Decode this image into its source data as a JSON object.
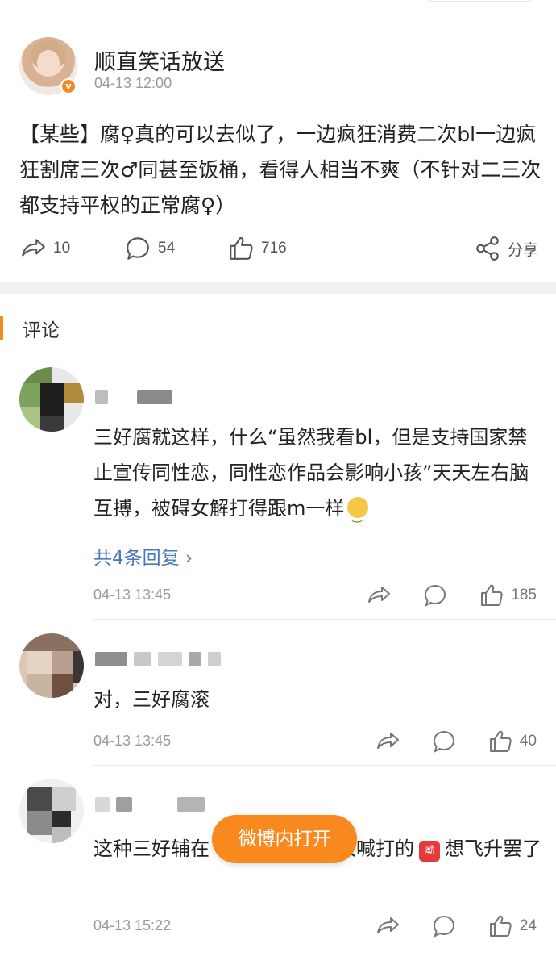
{
  "post": {
    "username": "顺直笑话放送",
    "time": "04-13 12:00",
    "content": "【某些】腐♀真的可以去似了，一边疯狂消费二次bl一边疯狂割席三次♂同甚至饭桶，看得人相当不爽（不针对二三次都支持平权的正常腐♀）",
    "reposts": "10",
    "comments": "54",
    "likes": "716",
    "share_label": "分享"
  },
  "comments_section": {
    "title": "评论"
  },
  "comments": [
    {
      "text": "三好腐就这样，什么“虽然我看bl，但是支持国家禁止宣传同性恋，同性恋作品会影响小孩”天天左右脑互搏，被碍女解打得跟m一样",
      "replies": "共4条回复 ›",
      "time": "04-13 13:45",
      "likes": "185"
    },
    {
      "text": "对，三好腐滚",
      "time": "04-13 13:45",
      "likes": "40"
    },
    {
      "text_a": "这种三好辅在",
      "text_b": "人喊打的",
      "emoji": "呦",
      "text_c": "想飞升罢了",
      "time": "04-13 15:22",
      "likes": "24"
    }
  ],
  "overlay": {
    "open_in_weibo": "微博内打开"
  },
  "colors": {
    "accent": "#f08a24",
    "link": "#4a78b8"
  }
}
